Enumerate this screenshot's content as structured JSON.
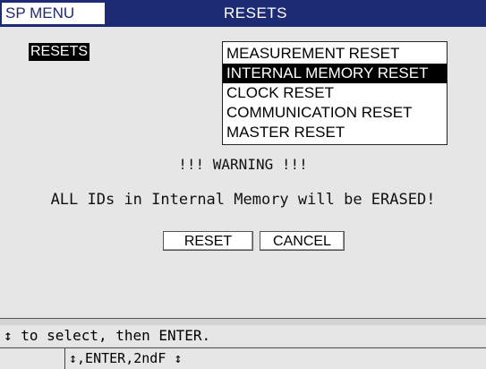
{
  "header": {
    "menu_label": "SP MENU",
    "title": "RESETS"
  },
  "section_label": "RESETS",
  "reset_list": {
    "items": [
      {
        "label": "MEASUREMENT RESET",
        "selected": false
      },
      {
        "label": "INTERNAL MEMORY RESET",
        "selected": true
      },
      {
        "label": "CLOCK RESET",
        "selected": false
      },
      {
        "label": "COMMUNICATION RESET",
        "selected": false
      },
      {
        "label": "MASTER RESET",
        "selected": false
      }
    ]
  },
  "warning": {
    "title": "!!! WARNING !!!",
    "message": "ALL IDs in Internal Memory will be ERASED!"
  },
  "buttons": {
    "reset": "RESET",
    "cancel": "CANCEL"
  },
  "status": {
    "hint": "↕ to select, then ENTER."
  },
  "keys": {
    "text": "↕,ENTER,2ndF ↕"
  },
  "colors": {
    "header_bg": "#1d2b74",
    "selection_bg": "#000000"
  }
}
